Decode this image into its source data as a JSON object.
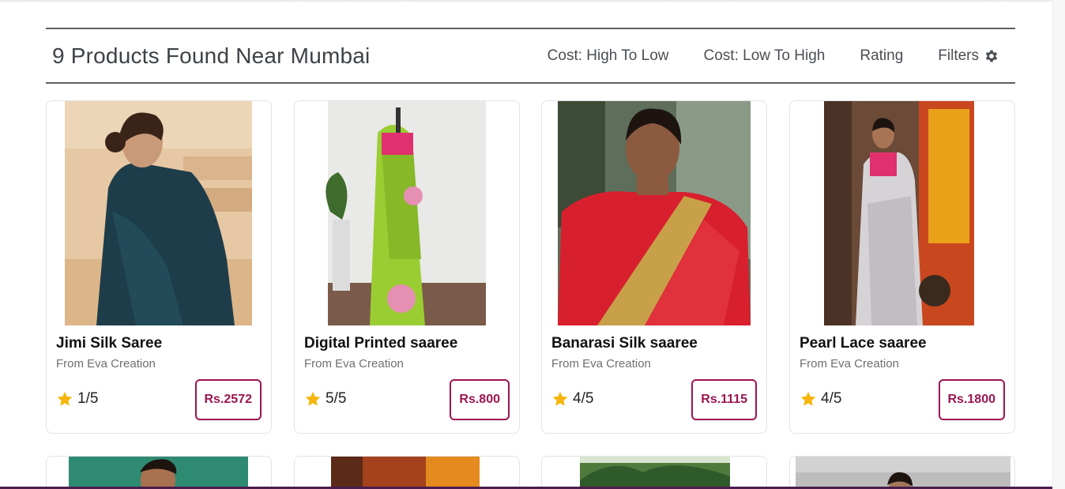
{
  "header": {
    "title": "9 Products Found Near Mumbai",
    "sort_high_low": "Cost: High To Low",
    "sort_low_high": "Cost: Low To High",
    "sort_rating": "Rating",
    "filters_label": "Filters",
    "filters_icon": "gear-icon"
  },
  "colors": {
    "accent": "#9b1650",
    "star": "#f5b50a",
    "divider": "#5d6165"
  },
  "products": [
    {
      "name": "Jimi Silk Saree",
      "seller": "From Eva Creation",
      "rating": "1/5",
      "price": "Rs.2572",
      "image": "woman in dark teal silk saree seated on steps"
    },
    {
      "name": "Digital Printed saaree",
      "seller": "From Eva Creation",
      "rating": "5/5",
      "price": "Rs.800",
      "image": "green printed saree draped on mannequin"
    },
    {
      "name": "Banarasi Silk saaree",
      "seller": "From Eva Creation",
      "rating": "4/5",
      "price": "Rs.1115",
      "image": "smiling woman in red and gold banarasi saree"
    },
    {
      "name": "Pearl Lace saaree",
      "seller": "From Eva Creation",
      "rating": "4/5",
      "price": "Rs.1800",
      "image": "woman in silver lace saree by orange wall"
    }
  ],
  "next_row_images": [
    "woman in green saree",
    "woman near orange doorway",
    "palm trees backdrop",
    "woman in grey studio"
  ]
}
